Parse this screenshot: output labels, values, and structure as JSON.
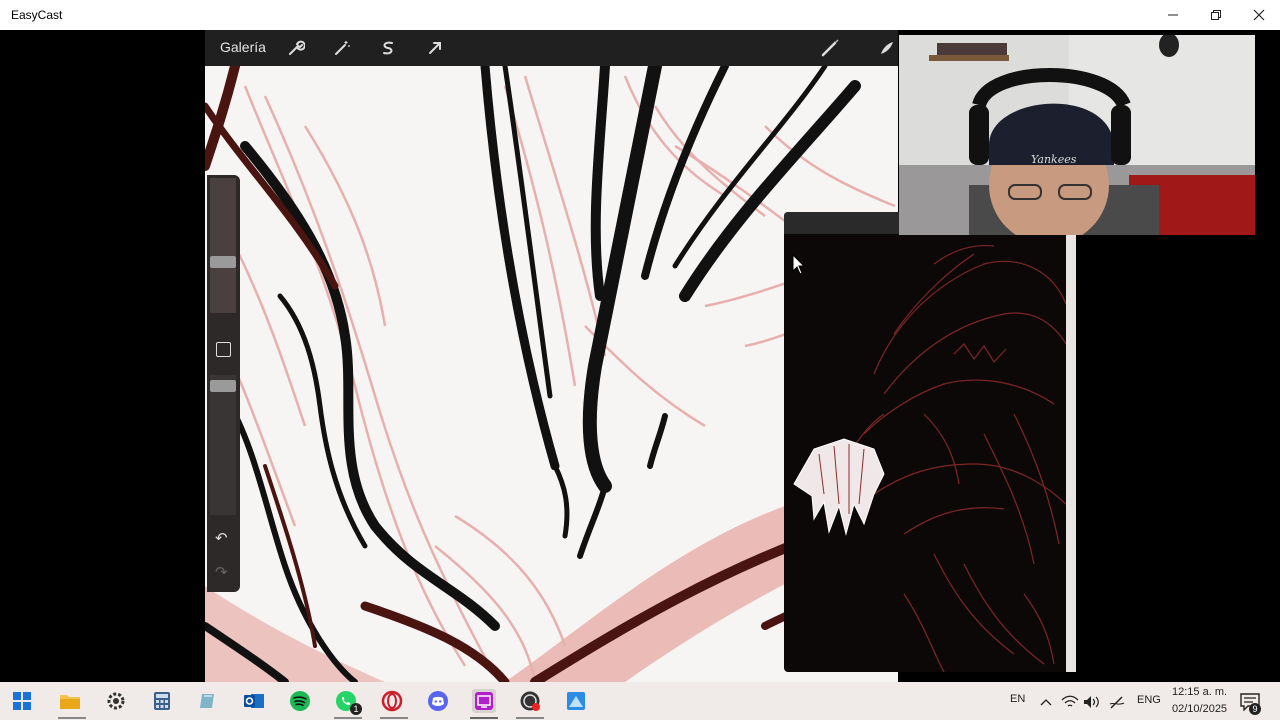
{
  "window": {
    "title": "EasyCast"
  },
  "app": {
    "gallery_label": "Galería"
  },
  "taskbar": {
    "whatsapp_badge": "1",
    "language_short": "EN",
    "language_code": "ENG",
    "time": "12:15 a. m.",
    "date": "02/10/2025",
    "notification_count": "9"
  },
  "colors": {
    "canvas_bg": "#f7f5f4",
    "sketch_pink": "#e6a9a5",
    "ink_black": "#111111",
    "ink_maroon": "#4a1410",
    "ref_line": "#8b2a28",
    "toolbar": "#202020"
  }
}
